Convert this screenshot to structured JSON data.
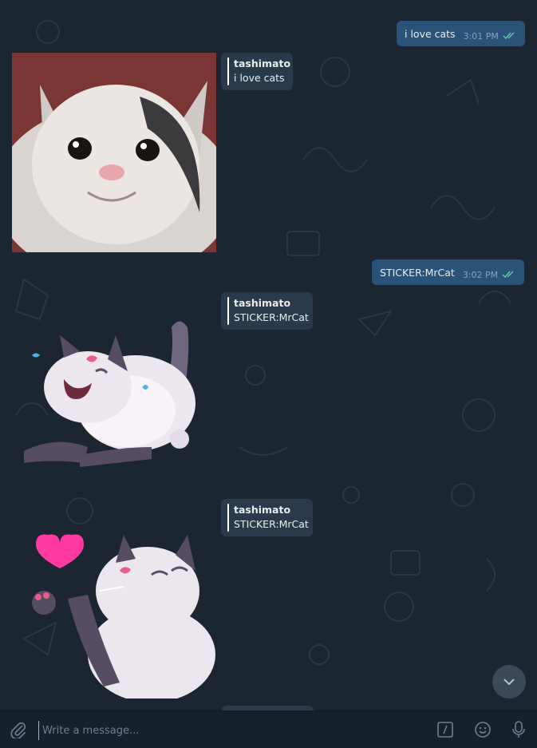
{
  "messages": [
    {
      "type": "outgoing",
      "text": "i love cats",
      "time": "3:01 PM"
    },
    {
      "type": "reply",
      "name": "tashimato",
      "text": "i love cats"
    },
    {
      "type": "outgoing",
      "text": "STICKER:MrCat",
      "time": "3:02 PM"
    },
    {
      "type": "reply",
      "name": "tashimato",
      "text": "STICKER:MrCat"
    },
    {
      "type": "reply",
      "name": "tashimato",
      "text": "STICKER:MrCat"
    }
  ],
  "composer": {
    "placeholder": "Write a message..."
  },
  "icons": {
    "attach": "paperclip-icon",
    "commands": "slash-command-icon",
    "emoji": "smiley-icon",
    "voice": "microphone-icon",
    "scroll": "chevron-down-icon",
    "read": "double-check-icon"
  },
  "colors": {
    "background": "#1b2631",
    "outgoing_bubble": "#2b5278",
    "incoming_bubble": "#2a3a4a",
    "read_check": "#5ec8a4"
  }
}
